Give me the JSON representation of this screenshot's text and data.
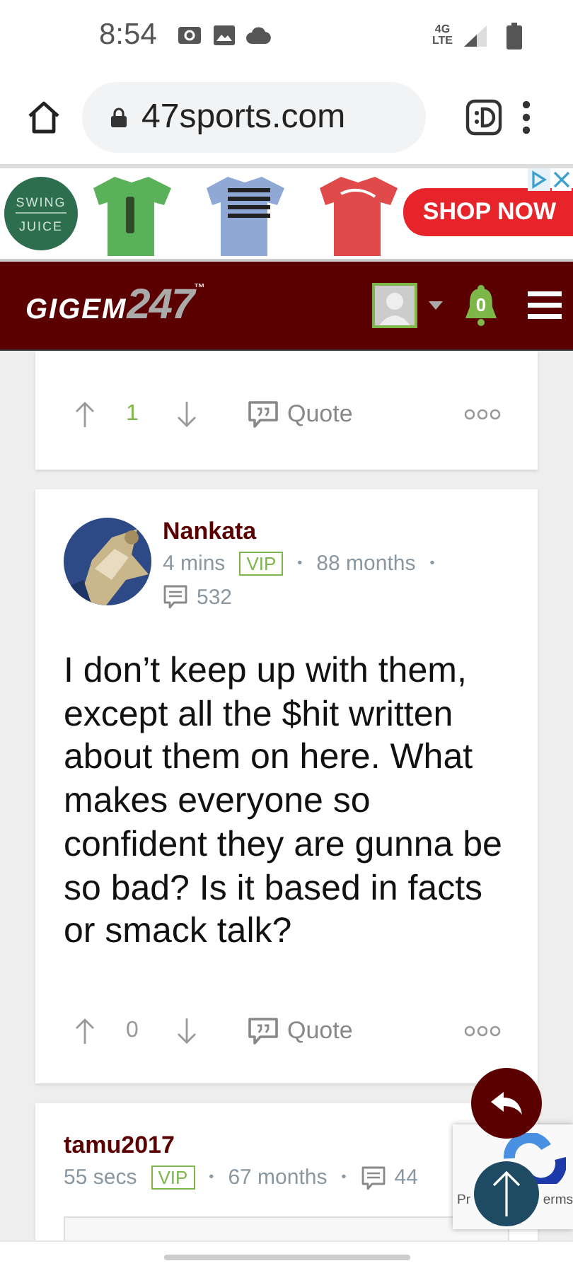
{
  "status_bar": {
    "time": "8:54",
    "network": [
      "4G",
      "LTE"
    ]
  },
  "browser": {
    "url": "47sports.com"
  },
  "ad": {
    "brand": [
      "SWING",
      "JUICE"
    ],
    "cta": "SHOP NOW"
  },
  "site_header": {
    "logo": [
      "GIGEM",
      "247",
      "™"
    ],
    "notifications": "0"
  },
  "posts": [
    {
      "score": "1",
      "score_positive": true,
      "quote_label": "Quote"
    },
    {
      "author": "Nankata",
      "avatar": {
        "kind": "picture"
      },
      "time": "4 mins",
      "badge": "VIP",
      "separators": [
        "•",
        "•"
      ],
      "tenure": "88 months",
      "comments": "532",
      "body": "I don’t keep up with them, except all the $hit written about them on here. What makes everyone so confident they are gunna be so bad? Is it based in facts or smack talk?",
      "score": "0",
      "score_positive": false,
      "quote_label": "Quote"
    },
    {
      "author": "tamu2017",
      "time": "55 secs",
      "badge": "VIP",
      "separators": [
        "•",
        "•"
      ],
      "tenure": "67 months",
      "comments": "44",
      "quote_box": true
    }
  ],
  "recaptcha": [
    "Pr",
    "erms"
  ]
}
